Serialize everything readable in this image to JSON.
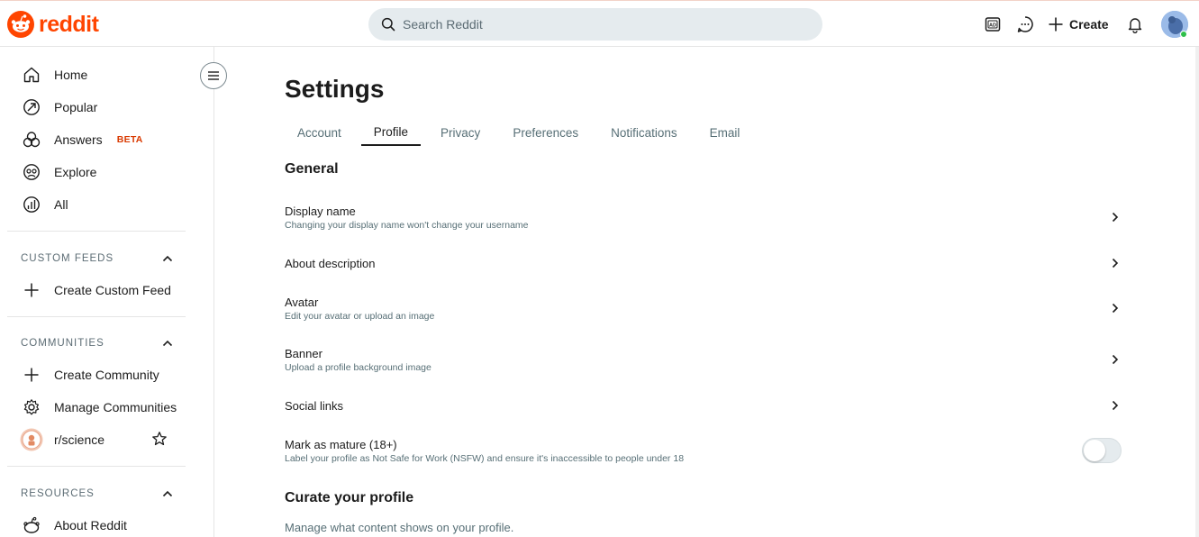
{
  "header": {
    "logo_text": "reddit",
    "search_placeholder": "Search Reddit",
    "create_label": "Create",
    "brand_color": "#ff4500",
    "icons": [
      "advertise-icon",
      "chat-icon",
      "plus-icon",
      "bell-icon"
    ]
  },
  "sidebar": {
    "nav": [
      {
        "label": "Home",
        "icon": "home-icon"
      },
      {
        "label": "Popular",
        "icon": "popular-icon"
      },
      {
        "label": "Answers",
        "icon": "answers-icon",
        "badge": "BETA"
      },
      {
        "label": "Explore",
        "icon": "explore-icon"
      },
      {
        "label": "All",
        "icon": "all-icon"
      }
    ],
    "custom_feeds": {
      "title": "CUSTOM FEEDS",
      "items": [
        {
          "label": "Create Custom Feed",
          "icon": "plus-icon"
        }
      ]
    },
    "communities": {
      "title": "COMMUNITIES",
      "items": [
        {
          "label": "Create Community",
          "icon": "plus-icon"
        },
        {
          "label": "Manage Communities",
          "icon": "gear-icon"
        },
        {
          "label": "r/science",
          "icon": "community-avatar"
        }
      ]
    },
    "resources": {
      "title": "RESOURCES",
      "items": [
        {
          "label": "About Reddit",
          "icon": "reddit-alien-icon"
        }
      ]
    }
  },
  "main": {
    "title": "Settings",
    "tabs": [
      {
        "label": "Account",
        "active": false
      },
      {
        "label": "Profile",
        "active": true
      },
      {
        "label": "Privacy",
        "active": false
      },
      {
        "label": "Preferences",
        "active": false
      },
      {
        "label": "Notifications",
        "active": false
      },
      {
        "label": "Email",
        "active": false
      }
    ],
    "general_title": "General",
    "rows": [
      {
        "label": "Display name",
        "desc": "Changing your display name won't change your username"
      },
      {
        "label": "About description",
        "desc": ""
      },
      {
        "label": "Avatar",
        "desc": "Edit your avatar or upload an image"
      },
      {
        "label": "Banner",
        "desc": "Upload a profile background image"
      },
      {
        "label": "Social links",
        "desc": ""
      },
      {
        "label": "Mark as mature (18+)",
        "desc": "Label your profile as Not Safe for Work (NSFW) and ensure it's inaccessible to people under 18",
        "toggle": false
      }
    ],
    "curate_title": "Curate your profile",
    "curate_desc": "Manage what content shows on your profile."
  }
}
